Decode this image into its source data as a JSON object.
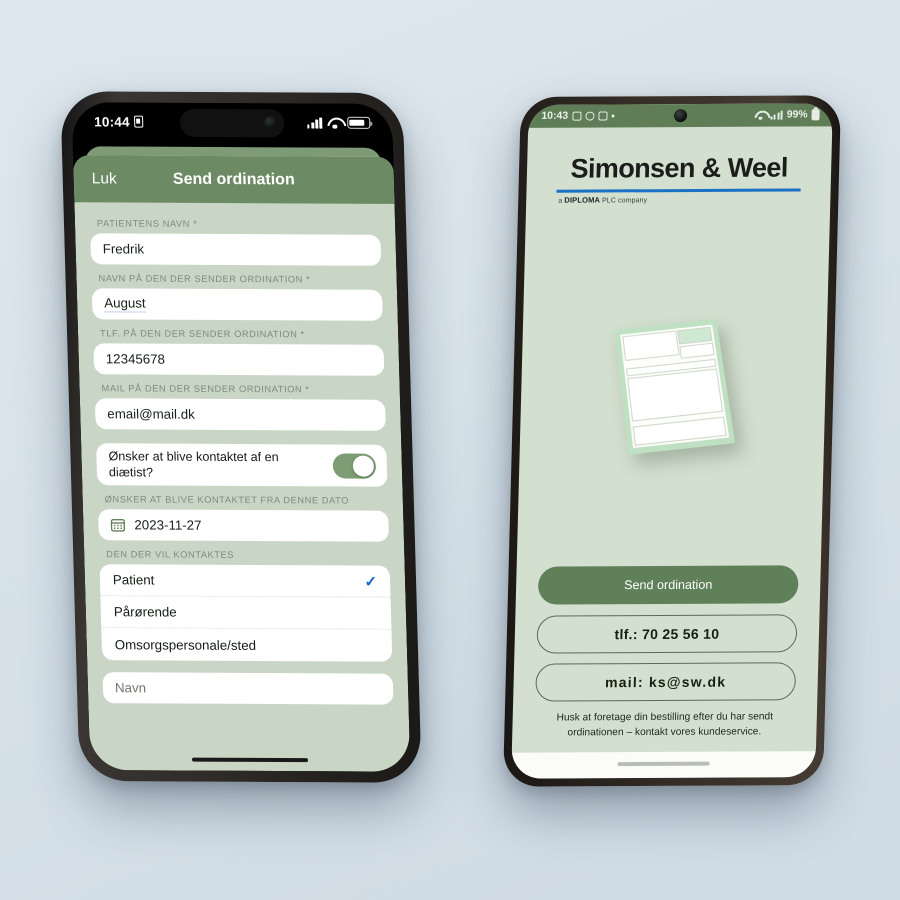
{
  "left_phone": {
    "status_bar": {
      "time": "10:44",
      "alarm_icon": "lock-icon"
    },
    "sheet": {
      "close_label": "Luk",
      "title": "Send ordination",
      "fields": [
        {
          "label": "PATIENTENS NAVN *",
          "value": "Fredrik"
        },
        {
          "label": "NAVN PÅ DEN DER SENDER ORDINATION *",
          "value": "August"
        },
        {
          "label": "TLF. PÅ DEN DER SENDER ORDINATION *",
          "value": "12345678"
        },
        {
          "label": "MAIL PÅ DEN DER SENDER ORDINATION *",
          "value": "email@mail.dk"
        }
      ],
      "toggle": {
        "label": "Ønsker at blive kontaktet af en diætist?",
        "state": "on"
      },
      "date": {
        "label": "ØNSKER AT BLIVE KONTAKTET FRA DENNE DATO",
        "value": "2023-11-27",
        "icon": "calendar-icon"
      },
      "contact_group": {
        "label": "DEN DER VIL KONTAKTES",
        "options": [
          {
            "text": "Patient",
            "selected": true
          },
          {
            "text": "Pårørende",
            "selected": false
          },
          {
            "text": "Omsorgspersonale/sted",
            "selected": false
          }
        ]
      },
      "name_field": {
        "placeholder": "Navn"
      }
    }
  },
  "right_phone": {
    "status_bar": {
      "time": "10:43",
      "battery": "99%"
    },
    "logo": {
      "name": "Simonsen & Weel",
      "tagline_prefix": "a ",
      "tagline_brand": "DIPLOMA",
      "tagline_suffix": " PLC company"
    },
    "illustration": "prescription-pad-illustration",
    "primary_button": "Send ordination",
    "phone_pill": "tlf.: 70 25 56 10",
    "mail_pill": "mail: ks@sw.dk",
    "note": "Husk at foretage din bestilling efter du har sendt ordinationen – kontakt vores kundeservice."
  },
  "colors": {
    "page_bg": "#dbe4ec",
    "sheet_header_green": "#6c8a64",
    "app_bg_green": "#c9d6c5",
    "android_bg_green": "#d3dfcf",
    "cta_green": "#5f8059",
    "toggle_green": "#7e9d74",
    "check_blue": "#1763d8",
    "logo_rule_blue": "#1b72c4"
  }
}
